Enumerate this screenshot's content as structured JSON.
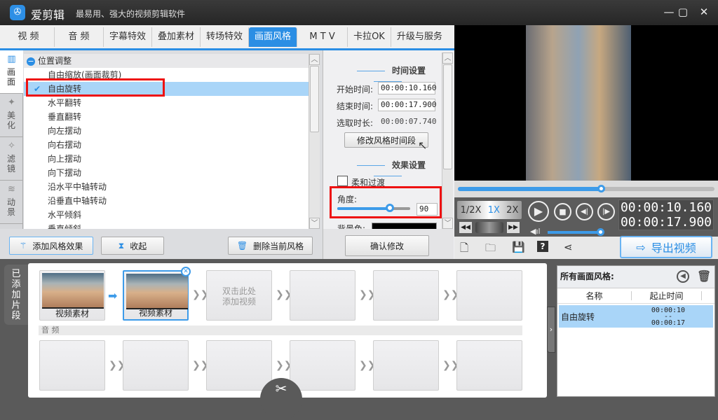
{
  "app": {
    "name": "爱剪辑",
    "slogan": "最易用、强大的视频剪辑软件"
  },
  "tabs": [
    "视 频",
    "音 频",
    "字幕特效",
    "叠加素材",
    "转场特效",
    "画面风格",
    "M T V",
    "卡拉OK",
    "升级与服务"
  ],
  "active_tab": "画面风格",
  "side_nav": [
    {
      "label": "画面",
      "icon": "screen-icon"
    },
    {
      "label": "美化",
      "icon": "magic-wand-icon"
    },
    {
      "label": "滤镜",
      "icon": "filter-wand-icon"
    },
    {
      "label": "动景",
      "icon": "waves-icon"
    }
  ],
  "style_list": {
    "group": "位置调整",
    "items": [
      "自由缩放(画面裁剪)",
      "自由旋转",
      "水平翻转",
      "垂直翻转",
      "向左摆动",
      "向右摆动",
      "向上摆动",
      "向下摆动",
      "沿水平中轴转动",
      "沿垂直中轴转动",
      "水平倾斜",
      "垂直倾斜"
    ],
    "selected": "自由旋转"
  },
  "buttons": {
    "add_style": "添加风格效果",
    "collapse": "收起",
    "delete_style": "删除当前风格",
    "modify_period": "修改风格时间段",
    "confirm": "确认修改",
    "export": "导出视频"
  },
  "time_settings": {
    "title": "时间设置",
    "start_label": "开始时间:",
    "start": "00:00:10.160",
    "end_label": "结束时间:",
    "end": "00:00:17.900",
    "duration_label": "选取时长:",
    "duration": "00:00:07.740"
  },
  "effect_settings": {
    "title": "效果设置",
    "soft_transition": "柔和过渡",
    "soft_checked": false,
    "angle_label": "角度:",
    "angle": "90",
    "angle_fraction": 0.72,
    "bg_color_label": "背景色:",
    "bg_color": "#000000"
  },
  "player": {
    "progress_fraction": 0.56,
    "speeds": [
      "1/2X",
      "1X",
      "2X"
    ],
    "active_speed": "1X",
    "time_current": "00:00:10.160",
    "time_total": "00:00:17.900",
    "volume_fraction": 1.0
  },
  "timeline": {
    "side_label": "已添加片段",
    "clips": [
      "视频素材",
      "视频素材"
    ],
    "add_placeholder": "双击此处\n添加视频",
    "audio_label": "音 频"
  },
  "style_panel": {
    "title": "所有画面风格:",
    "col_name": "名称",
    "col_time": "起止时间",
    "rows": [
      {
        "name": "自由旋转",
        "start": "00:00:10",
        "sep": "--",
        "end": "00:00:17"
      }
    ]
  },
  "colors": {
    "accent": "#2b8ee4",
    "selection": "#a9d5f8",
    "highlight_box": "#ee1111"
  }
}
